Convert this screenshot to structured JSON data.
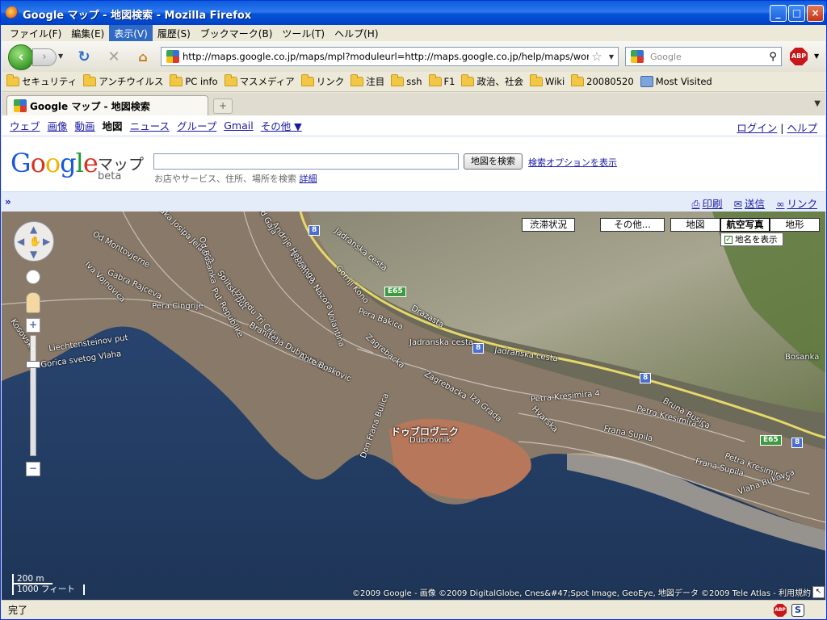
{
  "window": {
    "title": "Google マップ - 地図検索 - Mozilla Firefox"
  },
  "menu": [
    "ファイル(F)",
    "編集(E)",
    "表示(V)",
    "履歴(S)",
    "ブックマーク(B)",
    "ツール(T)",
    "ヘルプ(H)"
  ],
  "menu_active_index": 2,
  "nav": {
    "url": "http://maps.google.co.jp/maps/mpl?moduleurl=http://maps.google.co.jp/help/maps/worldmaps/m",
    "search_placeholder": "Google"
  },
  "bookmarks": [
    "セキュリティ",
    "アンチウイルス",
    "PC info",
    "マスメディア",
    "リンク",
    "注目",
    "ssh",
    "F1",
    "政治、社会",
    "Wiki",
    "20080520",
    "Most Visited"
  ],
  "tab": {
    "title": "Google マップ - 地図検索"
  },
  "gbar": {
    "links": [
      "ウェブ",
      "画像",
      "動画",
      "地図",
      "ニュース",
      "グループ",
      "Gmail",
      "その他 ▼"
    ],
    "current": "地図",
    "login": "ログイン",
    "sep": " | ",
    "help": "ヘルプ"
  },
  "search": {
    "product": "マップ",
    "beta": "beta",
    "button": "地図を検索",
    "options": "検索オプションを表示",
    "hint": "お店やサービス、住所、場所を検索",
    "hint_link": "詳細"
  },
  "actions": {
    "expand": "»",
    "print": "印刷",
    "send": "送信",
    "link": "リンク"
  },
  "map": {
    "buttons": [
      "渋滞状況",
      "その他...",
      "地図",
      "航空写真",
      "地形"
    ],
    "selected_button": "航空写真",
    "labels_checkbox": "地名を表示",
    "labels_checked": true,
    "scale_metric": "200 m",
    "scale_imperial": "1000 フィート",
    "copyright": "©2009 Google - 画像 ©2009 DigitalGlobe, Cnes&#47;Spot Image, GeoEye, 地図データ ©2009 Tele Atlas - 利用規約",
    "place_names": {
      "city_jp": "ドゥブロヴニク",
      "city": "Dubrovnik",
      "bosanka": "Bosanka",
      "streets": [
        "Jadranska cesta",
        "Jadranska cesta",
        "Jadranska cesta",
        "Petra Kresimira 4",
        "Petra Kresimira 4",
        "Petra Kresimira 4",
        "Frana Supila",
        "Frana Supila",
        "Vlaha Bukovca",
        "Bruna Busica",
        "Iza Grada",
        "Hvarska",
        "Zagrebacka",
        "Zagrebacka",
        "Drazasta",
        "Pera Bakica",
        "Gornji Kono",
        "Vladimira Nazora",
        "Andrije Hebranga",
        "Od Gaja",
        "Splitski put",
        "Put Republike",
        "Izmedu Tri Crkve",
        "Branitelja Dubrovnika",
        "Ante Boskovic",
        "Volantina",
        "Pera Cingrije",
        "Gabra Rajceva",
        "Iva Vojnovica",
        "Od Montovjerne",
        "Liechtensteinov put",
        "Gorica svetog Vlaha",
        "Kosovska",
        "Baka Josipa Jelacica",
        "Od Bosanka",
        "Don Frana Bulica"
      ],
      "shields": [
        "8",
        "8",
        "8",
        "8",
        "E65",
        "E65"
      ]
    }
  },
  "status": {
    "text": "完了"
  }
}
